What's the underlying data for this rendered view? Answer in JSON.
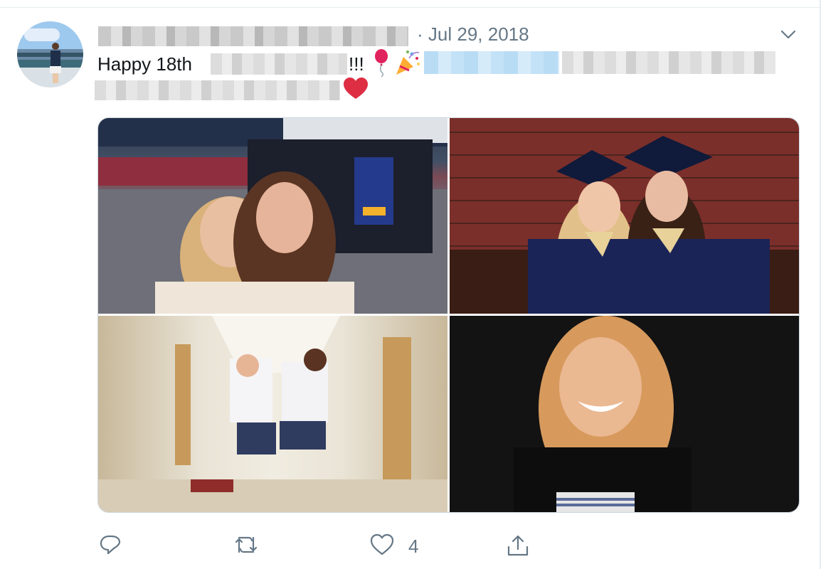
{
  "tweet": {
    "date_separator": "·",
    "date": "Jul 29, 2018",
    "text_prefix": "Happy 18th",
    "text_exclaim": "!!!",
    "emojis": [
      "balloon-emoji",
      "party-popper-emoji",
      "red-heart-emoji"
    ],
    "media_count": 4
  },
  "actions": {
    "reply_icon": "reply-icon",
    "retweet_icon": "retweet-icon",
    "like_icon": "heart-icon",
    "like_count": "4",
    "share_icon": "share-icon"
  },
  "colors": {
    "text": "#14171a",
    "secondary": "#657786",
    "border": "#e6ecf0",
    "heart": "#e0245e"
  }
}
